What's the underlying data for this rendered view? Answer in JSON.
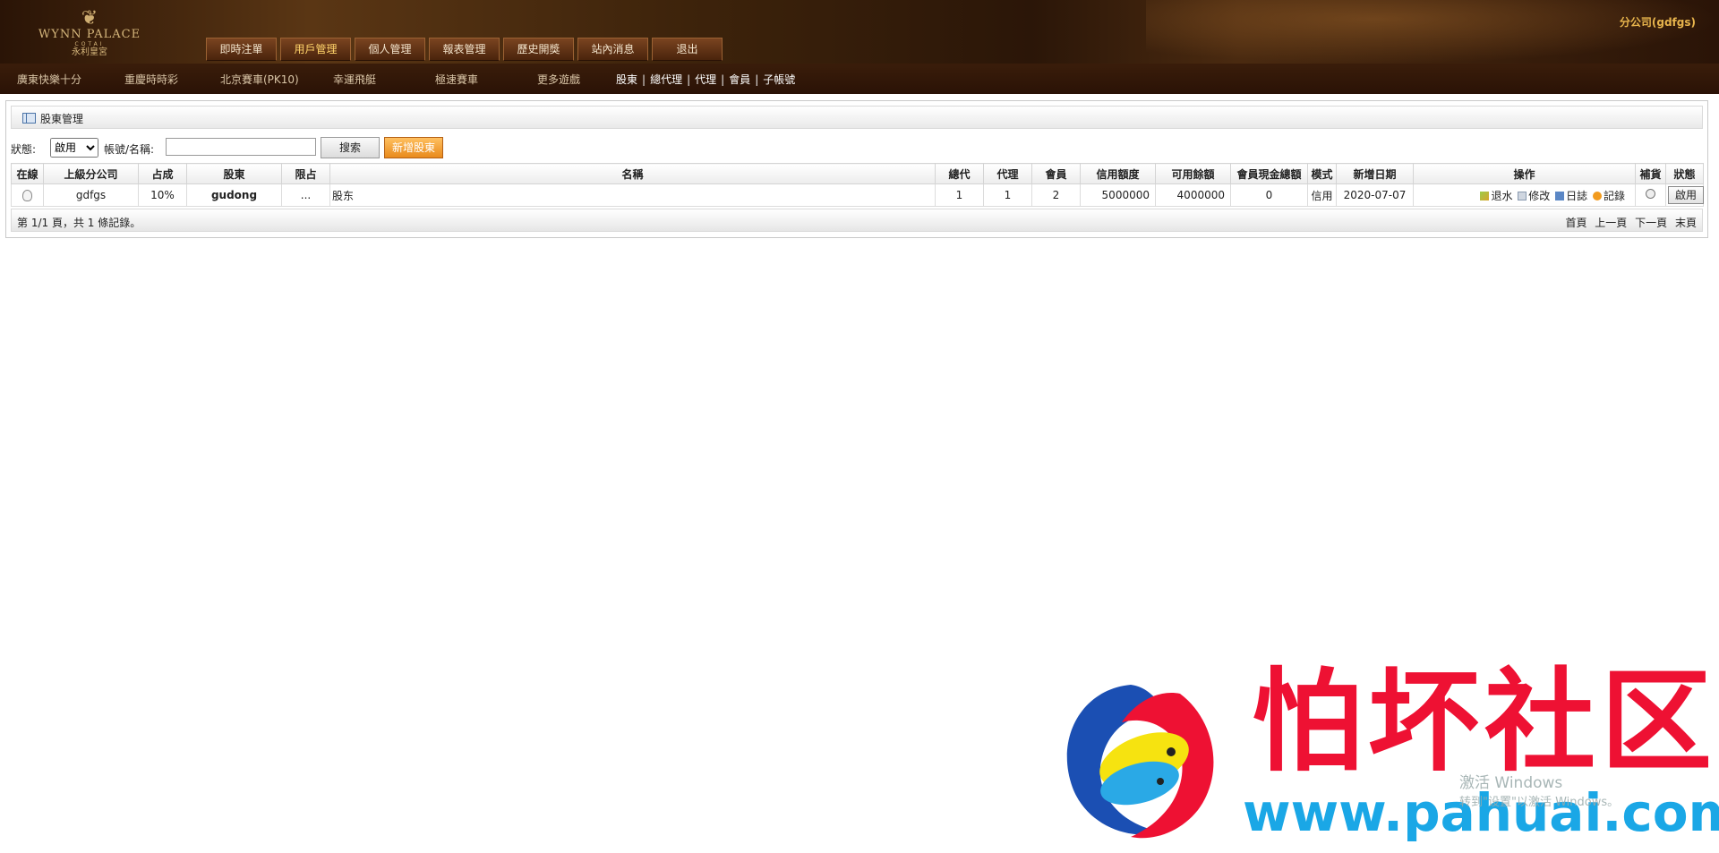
{
  "header": {
    "logo": {
      "brand": "WYNN PALACE",
      "sub1": "COTAI",
      "sub2": "永利皇宮"
    },
    "company": "分公司(gdfgs)",
    "nav": [
      "即時注單",
      "用戶管理",
      "個人管理",
      "報表管理",
      "歷史開獎",
      "站內消息",
      "退出"
    ],
    "active_nav": "用戶管理"
  },
  "subbar": {
    "games": [
      "廣東快樂十分",
      "重慶時時彩",
      "北京賽車(PK10)",
      "幸運飛艇",
      "極速賽車",
      "更多遊戲"
    ],
    "user_links": [
      "股東",
      "總代理",
      "代理",
      "會員",
      "子帳號"
    ],
    "separator": "|"
  },
  "panel": {
    "title": "股東管理",
    "filter": {
      "status_label": "狀態:",
      "status_value": "啟用",
      "account_label": "帳號/名稱:",
      "account_value": "",
      "search_label": "搜索",
      "add_label": "新增股東"
    },
    "columns": [
      "在線",
      "上級分公司",
      "占成",
      "股東",
      "限占",
      "名稱",
      "總代",
      "代理",
      "會員",
      "信用額度",
      "可用餘額",
      "會員現金總額",
      "模式",
      "新增日期",
      "操作",
      "補貨",
      "狀態"
    ],
    "rows": [
      {
        "parent": "gdfgs",
        "share": "10%",
        "username": "gudong",
        "limit": "...",
        "name": "股东",
        "general_agents": "1",
        "agents": "1",
        "members": "2",
        "credit": "5000000",
        "available": "4000000",
        "member_cash": "0",
        "mode": "信用",
        "created": "2020-07-07",
        "ops": {
          "rebate": "退水",
          "edit": "修改",
          "log": "日誌",
          "record": "記錄"
        },
        "status": "啟用"
      }
    ],
    "footer": {
      "info": "第 1/1 頁，共 1 條記錄。",
      "pager": [
        "首頁",
        "上一頁",
        "下一頁",
        "末頁"
      ]
    }
  },
  "watermark": {
    "chinese": "怕坏社区",
    "url": "www.pahuai.com",
    "activate_line1": "激活 Windows",
    "activate_line2": "转到\"设置\"以激活 Windows。"
  }
}
